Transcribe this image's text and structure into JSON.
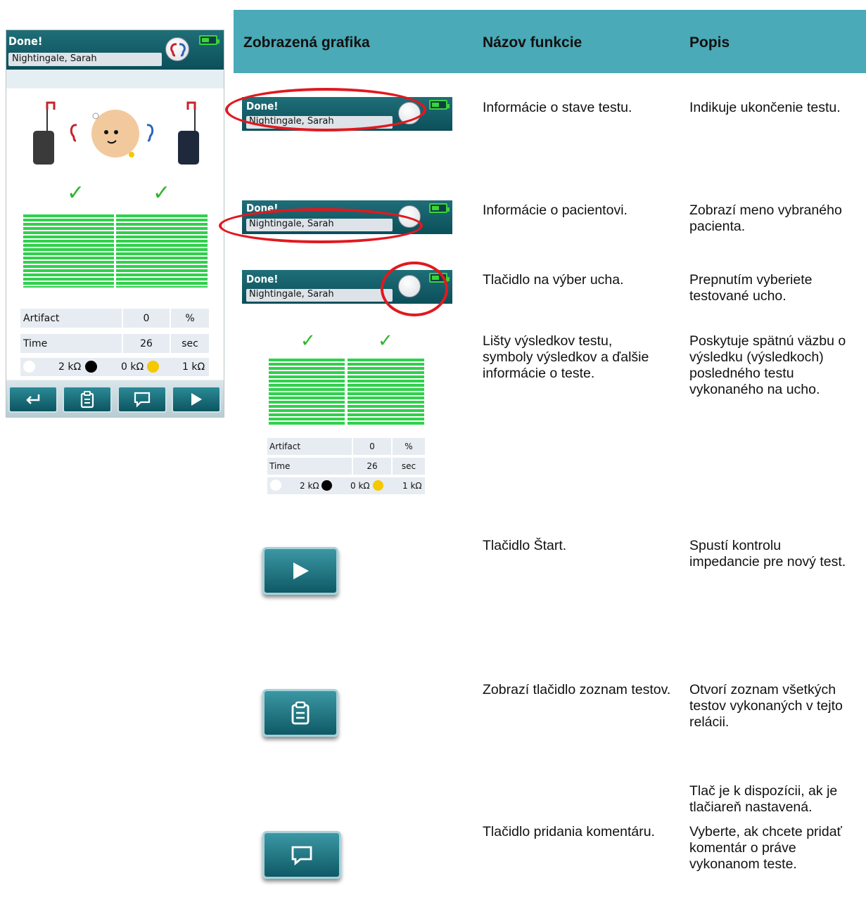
{
  "device": {
    "status": "Done!",
    "patient": "Nightingale, Sarah",
    "info_rows": [
      {
        "label": "Artifact",
        "value": "0",
        "unit": "%"
      },
      {
        "label": "Time",
        "value": "26",
        "unit": "sec"
      }
    ],
    "impedance": [
      {
        "value": "2 kΩ",
        "color": "#000000"
      },
      {
        "value": "0 kΩ",
        "color": "#f5c800"
      },
      {
        "value": "1 kΩ",
        "color": "#ffffff"
      }
    ],
    "check_mark": "✓",
    "toolbar": [
      "return-icon",
      "clipboard-icon",
      "comment-icon",
      "play-icon"
    ]
  },
  "table": {
    "headers": {
      "graphic": "Zobrazená grafika",
      "name": "Názov funkcie",
      "desc": "Popis"
    },
    "rows": [
      {
        "name": "Informácie o stave testu.",
        "desc": "Indikuje ukončenie testu."
      },
      {
        "name": "Informácie o pacientovi.",
        "desc": "Zobrazí meno vybraného pacienta."
      },
      {
        "name": "Tlačidlo na výber ucha.",
        "desc": "Prepnutím vyberiete testované ucho."
      },
      {
        "name": "Lišty výsledkov testu, symboly výsledkov a ďalšie informácie o teste.",
        "desc": "Poskytuje spätnú väzbu o výsledku (výsledkoch) posledného testu vykonaného na ucho."
      },
      {
        "name": "Tlačidlo Štart.",
        "desc": "Spustí kontrolu impedancie pre nový test."
      },
      {
        "name": "Zobrazí tlačidlo zoznam testov.",
        "desc": "Otvorí zoznam všetkých testov vykonaných v tejto relácii."
      },
      {
        "name": "",
        "desc": "Tlač je k dispozícii, ak je tlačiareň nastavená."
      },
      {
        "name": "Tlačidlo pridania komentáru.",
        "desc": "Vyberte, ak chcete pridať komentár o práve vykonanom teste."
      }
    ]
  },
  "colors": {
    "teal_header": "#4aaab7",
    "device_teal": "#0b4f5a",
    "result_green": "#2fd14b",
    "highlight_red": "#e0191f"
  }
}
